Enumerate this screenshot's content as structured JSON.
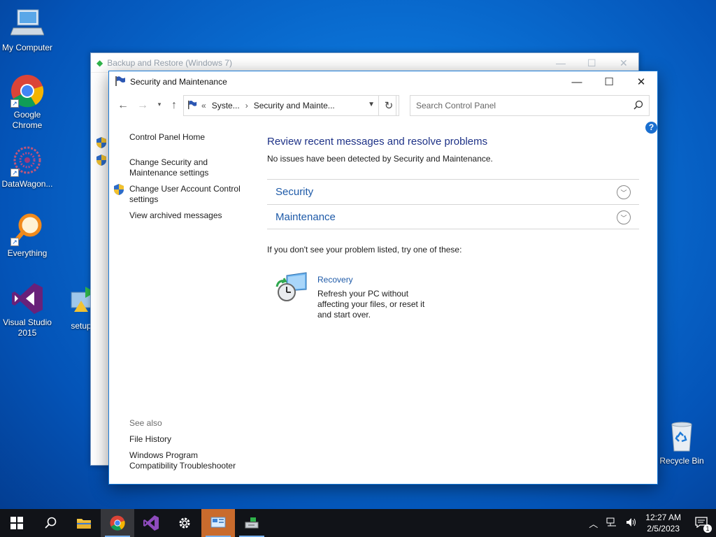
{
  "desktop": {
    "icons": [
      {
        "label": "My Computer"
      },
      {
        "label": "Google Chrome"
      },
      {
        "label": "DataWagon..."
      },
      {
        "label": "Everything"
      },
      {
        "label": "Visual Studio 2015"
      },
      {
        "label": "setup"
      },
      {
        "label": "Recycle Bin"
      }
    ]
  },
  "bg_window": {
    "title": "Backup and Restore (Windows 7)"
  },
  "window": {
    "title": "Security and Maintenance",
    "address": {
      "crumb1": "Syste...",
      "crumb2": "Security and Mainte..."
    },
    "search": {
      "placeholder": "Search Control Panel"
    },
    "left_pane": {
      "home": "Control Panel Home",
      "change_security": "Change Security and Maintenance settings",
      "change_uac": "Change User Account Control settings",
      "view_archived": "View archived messages",
      "see_also": "See also",
      "file_history": "File History",
      "compat": "Windows Program Compatibility Troubleshooter"
    },
    "main": {
      "heading": "Review recent messages and resolve problems",
      "subtext": "No issues have been detected by Security and Maintenance.",
      "sections": [
        {
          "label": "Security"
        },
        {
          "label": "Maintenance"
        }
      ],
      "try_line": "If you don't see your problem listed, try one of these:",
      "recovery": {
        "title": "Recovery",
        "description": "Refresh your PC without affecting your files, or reset it and start over."
      }
    }
  },
  "taskbar": {
    "clock_time": "12:27 AM",
    "clock_date": "2/5/2023",
    "notification_count": "1"
  },
  "colors": {
    "accent": "#1779d6",
    "link": "#1e5aa8",
    "heading": "#1e3287"
  }
}
